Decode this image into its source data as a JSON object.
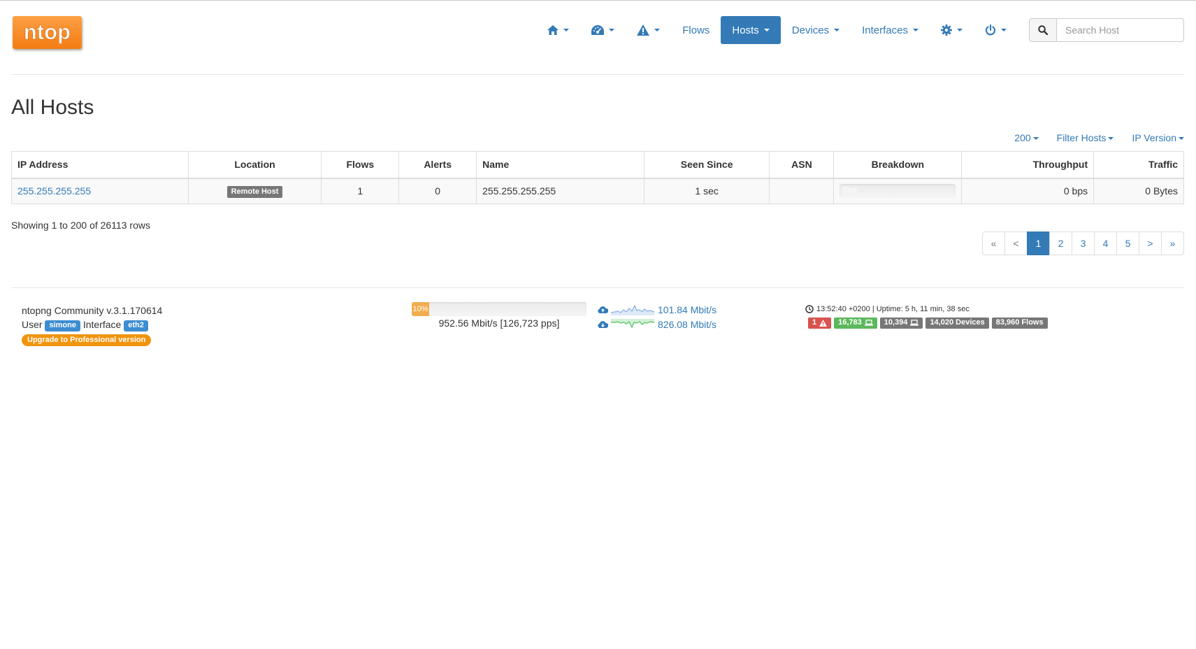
{
  "brand": {
    "logo_text": "ntop"
  },
  "nav": {
    "items": [
      {
        "name": "home",
        "icon": "home-icon"
      },
      {
        "name": "dashboard",
        "icon": "dashboard-icon"
      },
      {
        "name": "alerts",
        "icon": "warning-icon"
      },
      {
        "name": "flows",
        "label": "Flows"
      },
      {
        "name": "hosts",
        "label": "Hosts",
        "active": true
      },
      {
        "name": "devices",
        "label": "Devices"
      },
      {
        "name": "interfaces",
        "label": "Interfaces"
      },
      {
        "name": "settings",
        "icon": "gear-icon"
      },
      {
        "name": "power",
        "icon": "power-icon"
      }
    ],
    "search_placeholder": "Search Host",
    "accent_color": "#337ab7"
  },
  "page": {
    "title": "All Hosts",
    "toolbar": {
      "per_page": "200",
      "filter": "Filter Hosts",
      "ip_version": "IP Version"
    }
  },
  "table": {
    "columns": [
      "IP Address",
      "Location",
      "Flows",
      "Alerts",
      "Name",
      "Seen Since",
      "ASN",
      "Breakdown",
      "Throughput",
      "Traffic"
    ],
    "rows": [
      {
        "ip": "255.255.255.255",
        "location": "Remote Host",
        "flows": "1",
        "alerts": "0",
        "name": "255.255.255.255",
        "seen_since": "1 sec",
        "asn": "",
        "breakdown": "Sent",
        "throughput": "0 bps",
        "traffic": "0 Bytes"
      }
    ],
    "showing": "Showing 1 to 200 of 26113 rows"
  },
  "pagination": {
    "pages": [
      "«",
      "<",
      "1",
      "2",
      "3",
      "4",
      "5",
      ">",
      "»"
    ],
    "active": "1"
  },
  "footer": {
    "version": "ntopng Community v.3.1.170614",
    "user_label": "User",
    "user": "simone",
    "interface_label": "Interface",
    "interface": "eth2",
    "upgrade": "Upgrade to Professional version",
    "load_percent": 10,
    "load_label": "10%",
    "throughput": "952.56 Mbit/s [126,723 pps]",
    "upload_rate": "101.84 Mbit/s",
    "download_rate": "826.08 Mbit/s",
    "clock": "13:52:40 +0200 | Uptime: 5 h, 11 min, 38 sec",
    "counters": {
      "alerts": "1",
      "local_hosts": "16,783",
      "remote_hosts": "10,394",
      "devices": "14,020 Devices",
      "flows": "83,960 Flows"
    }
  }
}
